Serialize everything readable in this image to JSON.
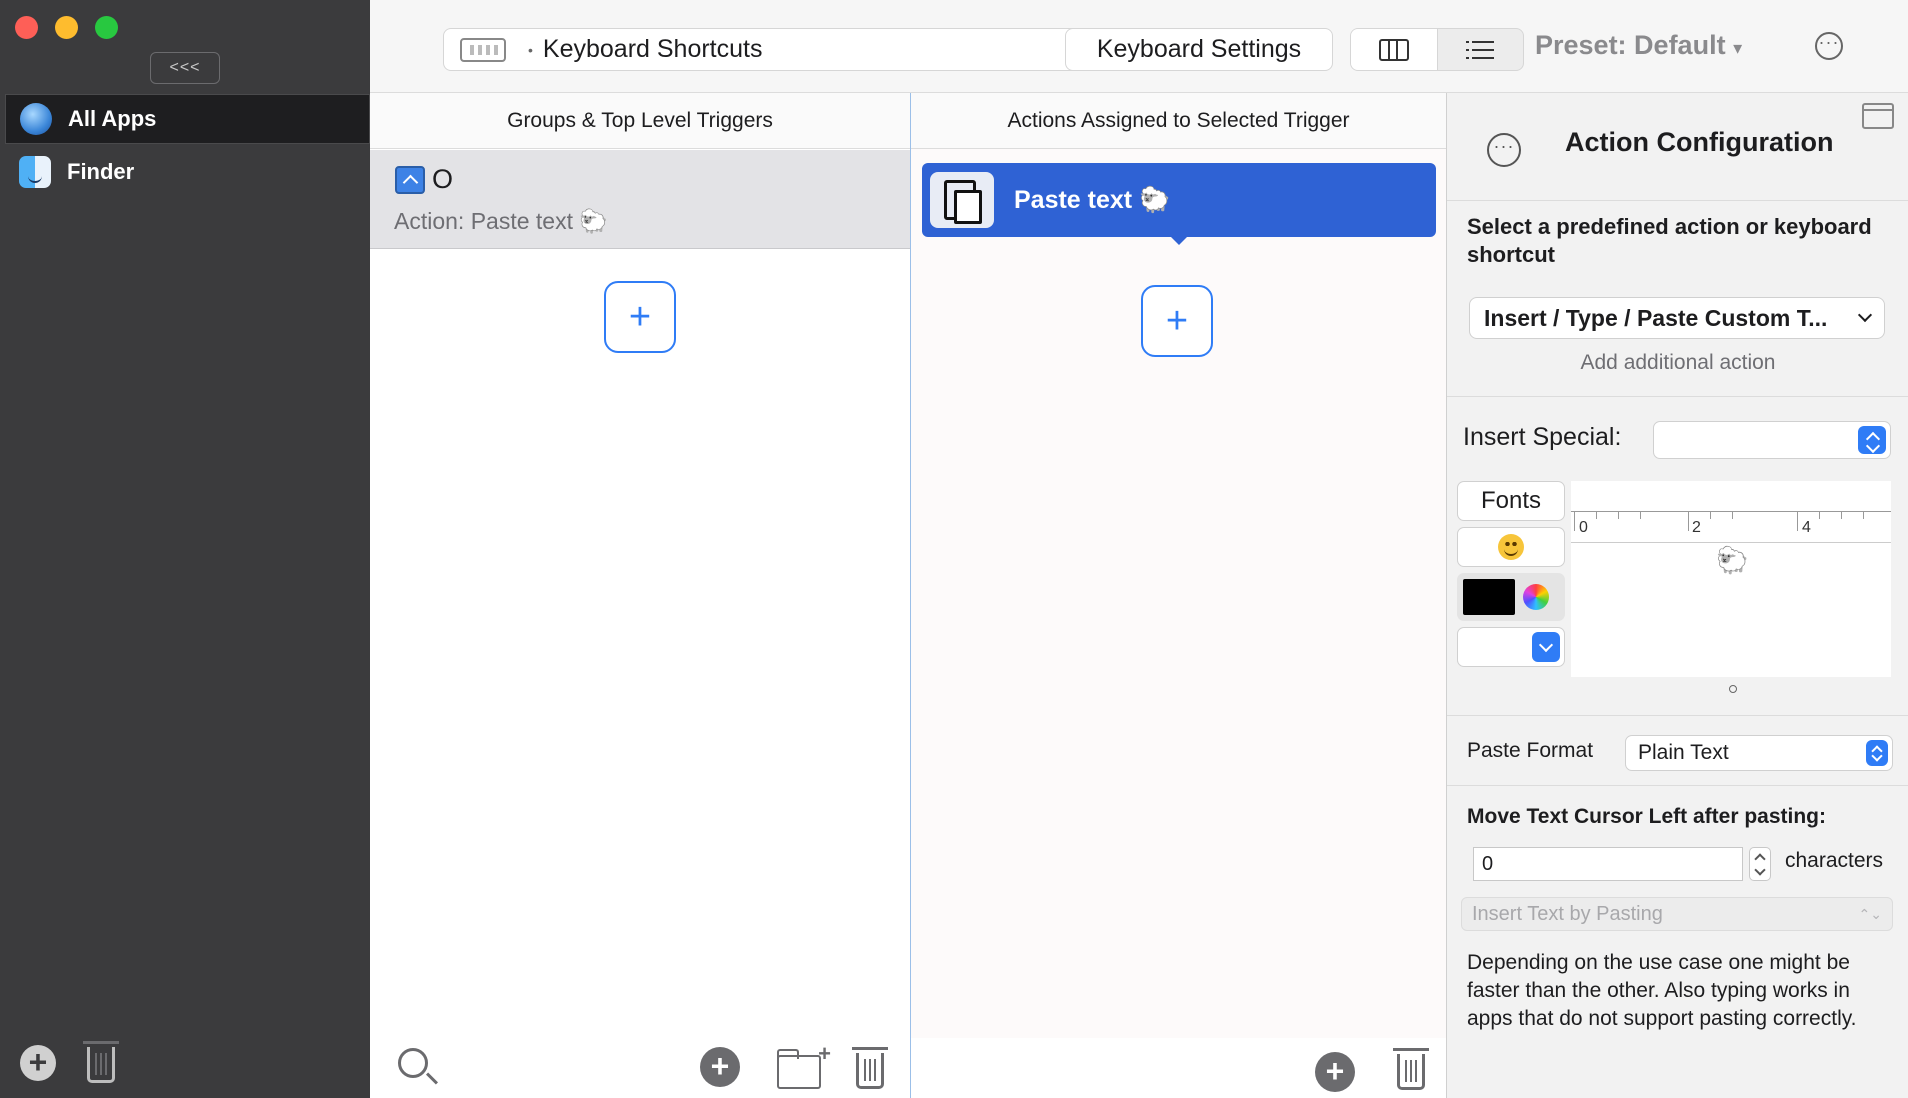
{
  "sidebar": {
    "collapse_label": "<<<",
    "items": [
      {
        "label": "All Apps",
        "icon": "globe-icon",
        "selected": true
      },
      {
        "label": "Finder",
        "icon": "finder-icon",
        "selected": false
      }
    ]
  },
  "toolbar": {
    "trigger_type": "Keyboard Shortcuts",
    "trigger_type_icon": "keyboard-icon",
    "keyboard_settings_label": "Keyboard Settings",
    "preset_label": "Preset: Default",
    "preset_chevron": "▾",
    "more_label": "···"
  },
  "groups": {
    "header": "Groups & Top Level Triggers",
    "trigger": {
      "key": "O",
      "key_icon": "control-key-icon",
      "action": "Action: Paste text",
      "emoji": "🐑"
    },
    "add_label": "+"
  },
  "actions": {
    "header": "Actions Assigned to Selected Trigger",
    "items": [
      {
        "label": "Paste text",
        "emoji": "🐑",
        "icon": "paste-icon"
      }
    ],
    "add_label": "+"
  },
  "config": {
    "title": "Action Configuration",
    "more_label": "···",
    "select_prompt": "Select a predefined action or keyboard shortcut",
    "predefined_value": "Insert / Type / Paste Custom T...",
    "add_additional": "Add additional action",
    "insert_special_label": "Insert Special:",
    "fonts_label": "Fonts",
    "ruler_labels": [
      "0",
      "2",
      "4"
    ],
    "editor_content": "🐑",
    "editor_handle": "o",
    "text_color": "#000000",
    "paste_format_label": "Paste Format",
    "paste_format_value": "Plain Text",
    "move_cursor_label": "Move Text Cursor Left after pasting:",
    "move_cursor_value": "0",
    "characters_label": "characters",
    "insert_mode_value": "Insert Text by Pasting",
    "insert_mode_arrows": "⌃⌄",
    "description": "Depending on the use case one might be faster than the other. Also typing works in apps that do not support pasting correctly."
  },
  "colors": {
    "accent": "#2f7cf6",
    "selected_action": "#2f62d4",
    "sidebar_bg": "#3b3b3d"
  }
}
